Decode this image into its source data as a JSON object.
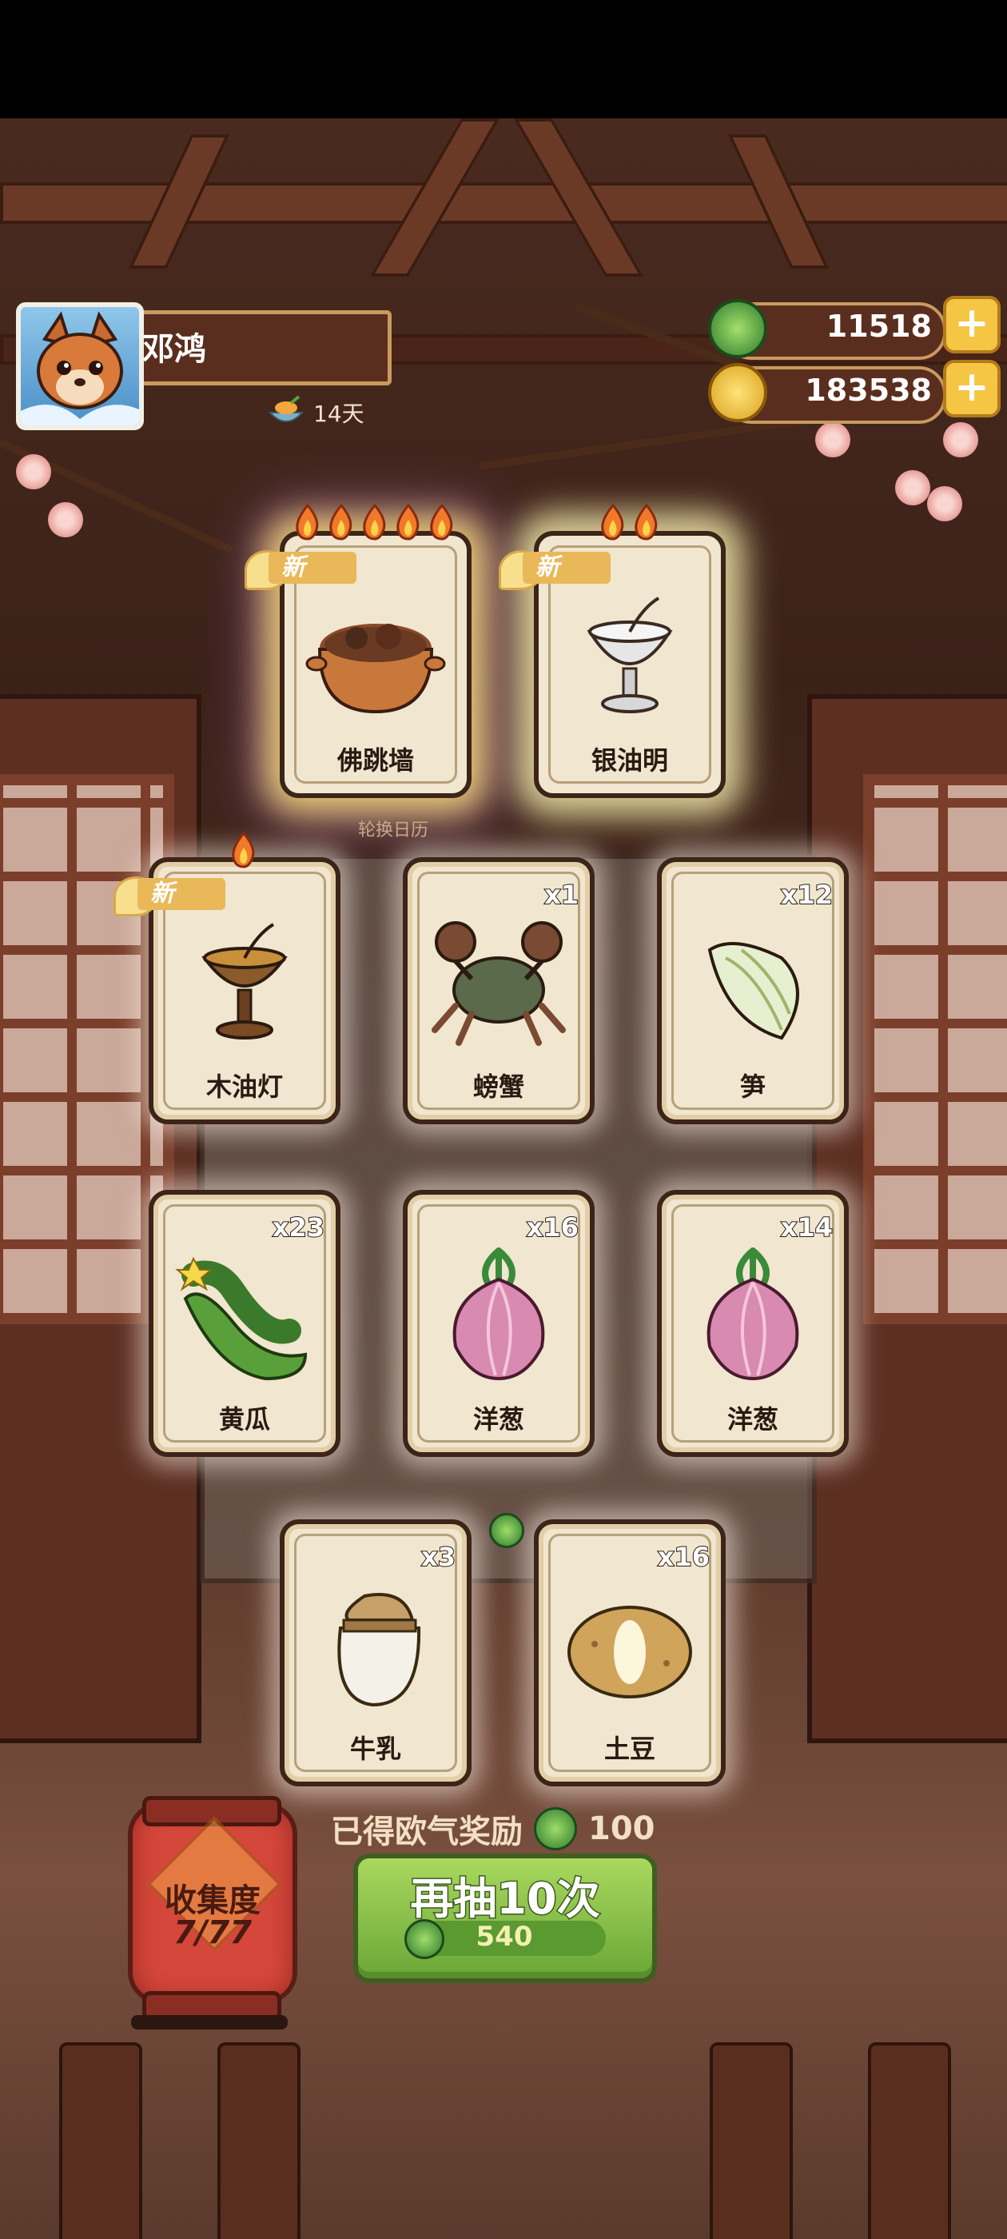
{
  "player": {
    "name": "邓鸿",
    "days": "14天"
  },
  "currency": {
    "jade": "11518",
    "coins": "183538"
  },
  "top_subtitle": "轮换日历",
  "cards": [
    {
      "name": "佛跳墙",
      "count": "",
      "new": "新",
      "flames": 5,
      "art": "soup-pot-icon"
    },
    {
      "name": "银油明",
      "count": "",
      "new": "新",
      "flames": 2,
      "art": "silver-lamp-icon"
    },
    {
      "name": "木油灯",
      "count": "",
      "new": "新",
      "flames": 1,
      "art": "wood-lamp-icon"
    },
    {
      "name": "螃蟹",
      "count": "x1",
      "art": "crab-icon"
    },
    {
      "name": "笋",
      "count": "x12",
      "art": "bamboo-shoot-icon"
    },
    {
      "name": "黄瓜",
      "count": "x23",
      "art": "cucumber-icon"
    },
    {
      "name": "洋葱",
      "count": "x16",
      "art": "onion-icon"
    },
    {
      "name": "洋葱",
      "count": "x14",
      "art": "onion-icon"
    },
    {
      "name": "牛乳",
      "count": "x3",
      "art": "milk-jar-icon"
    },
    {
      "name": "土豆",
      "count": "x16",
      "art": "potato-icon"
    }
  ],
  "luck_reward": {
    "label": "已得欧气奖励",
    "value": "100"
  },
  "collection": {
    "label": "收集度",
    "value": "7/77"
  },
  "draw_button": {
    "label": "再抽10次",
    "cost": "540"
  },
  "colors": {
    "card_bg": "#f1e6cf",
    "card_border": "#3c2418",
    "button_green": "#8cc44a",
    "lantern_red": "#d4473a"
  }
}
